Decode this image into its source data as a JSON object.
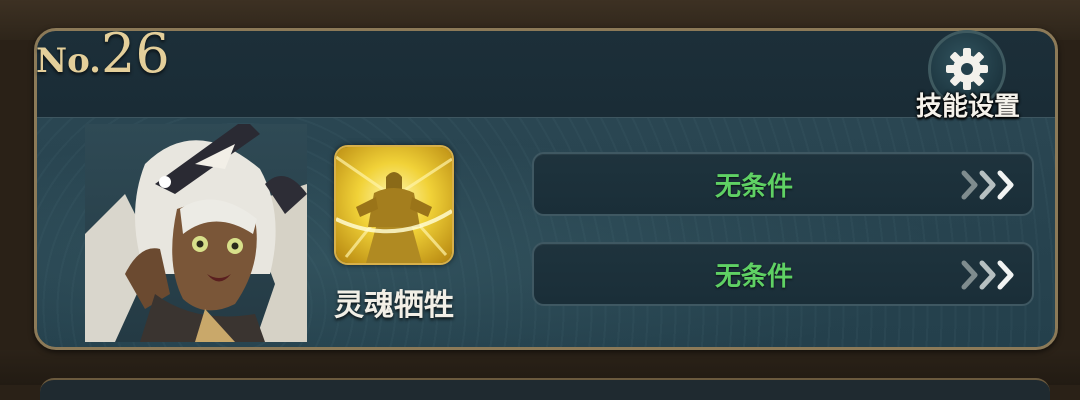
{
  "card": {
    "number_prefix": "No.",
    "number_value": "26"
  },
  "skill_settings": {
    "label": "技能设置",
    "icon": "gear-icon"
  },
  "character": {
    "portrait": "white-haired-girl-portrait"
  },
  "skill": {
    "name": "灵魂牺牲",
    "icon": "golden-warrior-skill-icon"
  },
  "conditions": [
    {
      "label": "无条件",
      "icon": "triple-chevron-right-icon"
    },
    {
      "label": "无条件",
      "icon": "triple-chevron-right-icon"
    }
  ],
  "colors": {
    "frame_gold": "#8c7a58",
    "number_gold": "#e4cf9a",
    "condition_green": "#5fd164",
    "panel_teal": "#24404c"
  }
}
